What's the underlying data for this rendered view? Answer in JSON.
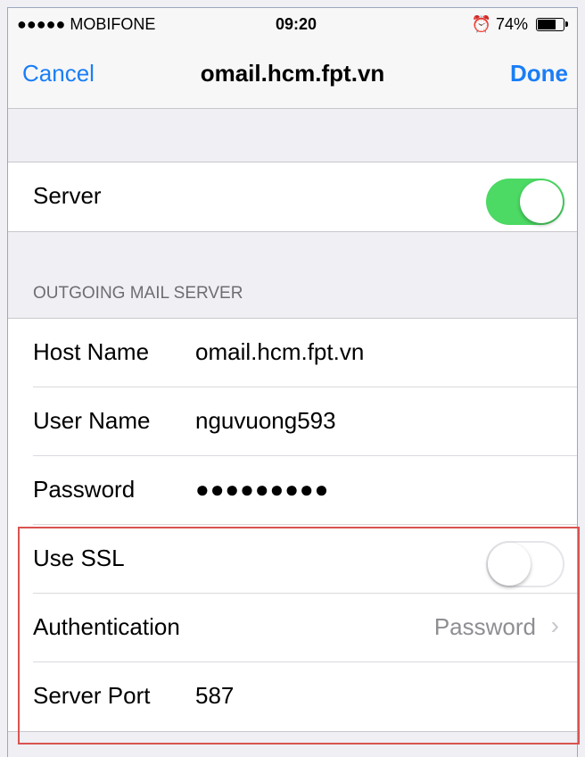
{
  "status_bar": {
    "carrier": "●●●●● MOBIFONE",
    "time": "09:20",
    "battery": "74%",
    "battery_level": 0.74
  },
  "nav": {
    "cancel": "Cancel",
    "title": "omail.hcm.fpt.vn",
    "done": "Done"
  },
  "server": {
    "label": "Server",
    "enabled": true
  },
  "outgoing": {
    "header": "OUTGOING MAIL SERVER",
    "host_name": {
      "label": "Host Name",
      "value": "omail.hcm.fpt.vn"
    },
    "user_name": {
      "label": "User Name",
      "value": "nguvuong593"
    },
    "password": {
      "label": "Password",
      "value": "●●●●●●●●●"
    },
    "use_ssl": {
      "label": "Use SSL",
      "enabled": false
    },
    "authentication": {
      "label": "Authentication",
      "value": "Password"
    },
    "server_port": {
      "label": "Server Port",
      "value": "587"
    }
  },
  "colors": {
    "accent": "#1a7ef7",
    "switch_on": "#4cd964",
    "highlight": "#d9534f"
  }
}
